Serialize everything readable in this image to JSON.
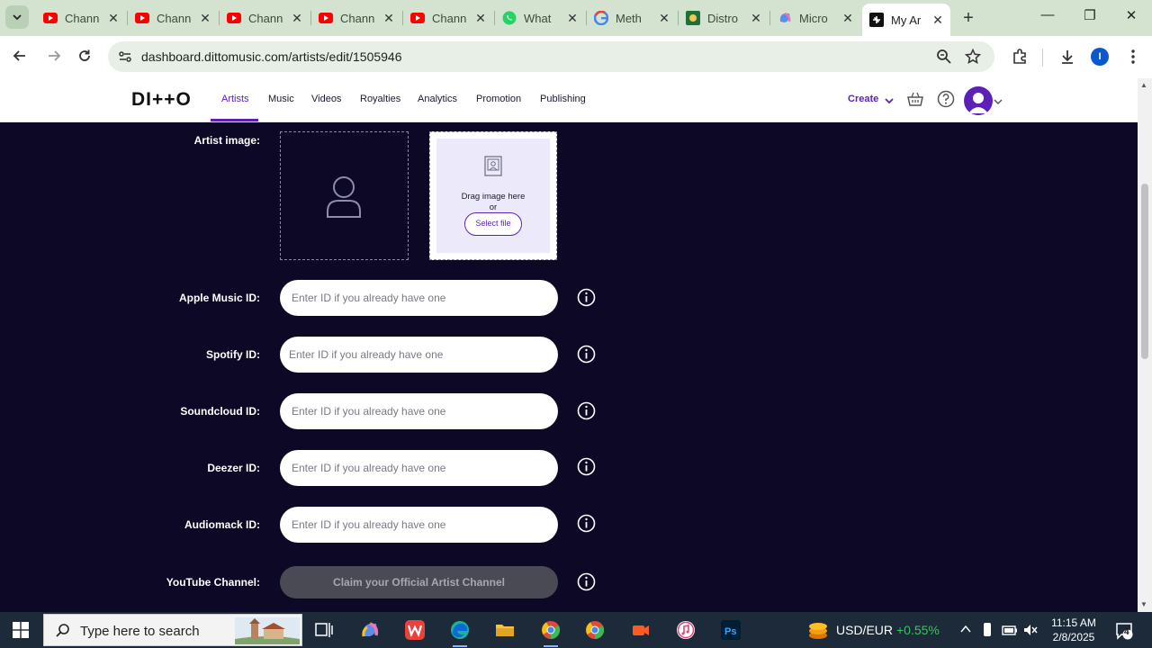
{
  "browser": {
    "tabs": [
      {
        "title": "Chann",
        "favicon": "youtube-icon"
      },
      {
        "title": "Chann",
        "favicon": "youtube-icon"
      },
      {
        "title": "Chann",
        "favicon": "youtube-icon"
      },
      {
        "title": "Chann",
        "favicon": "youtube-icon"
      },
      {
        "title": "Chann",
        "favicon": "youtube-icon"
      },
      {
        "title": "What",
        "favicon": "whatsapp-icon"
      },
      {
        "title": "Meth",
        "favicon": "google-icon"
      },
      {
        "title": "Distro",
        "favicon": "distrokid-icon"
      },
      {
        "title": "Micro",
        "favicon": "copilot-icon"
      },
      {
        "title": "My Ar",
        "favicon": "ditto-icon",
        "active": true
      }
    ],
    "url": "dashboard.dittomusic.com/artists/edit/1505946",
    "profile_initial": "I"
  },
  "header": {
    "logo": "DI++O",
    "nav": [
      "Artists",
      "Music",
      "Videos",
      "Royalties",
      "Analytics",
      "Promotion",
      "Publishing"
    ],
    "active_nav": "Artists",
    "create_label": "Create"
  },
  "form": {
    "artist_image_label": "Artist image:",
    "drag_text": "Drag image here",
    "or_text": "or",
    "select_file_label": "Select file",
    "fields": [
      {
        "label": "Apple Music ID:",
        "placeholder": "Enter ID if you already have one"
      },
      {
        "label": "Spotify ID:",
        "placeholder": "Enter ID if you already have one"
      },
      {
        "label": "Soundcloud ID:",
        "placeholder": "Enter ID if you already have one"
      },
      {
        "label": "Deezer ID:",
        "placeholder": "Enter ID if you already have one"
      },
      {
        "label": "Audiomack ID:",
        "placeholder": "Enter ID if you already have one"
      }
    ],
    "youtube_label": "YouTube Channel:",
    "claim_label": "Claim your Official Artist Channel"
  },
  "taskbar": {
    "search_placeholder": "Type here to search",
    "currency_label": "USD/EUR",
    "currency_change": "+0.55%",
    "time": "11:15 AM",
    "date": "2/8/2025",
    "notification_count": "4"
  },
  "colors": {
    "page_bg": "#0c0826",
    "accent": "#5b21b6",
    "tab_strip": "#d3e3d0",
    "positive": "#34c759"
  }
}
